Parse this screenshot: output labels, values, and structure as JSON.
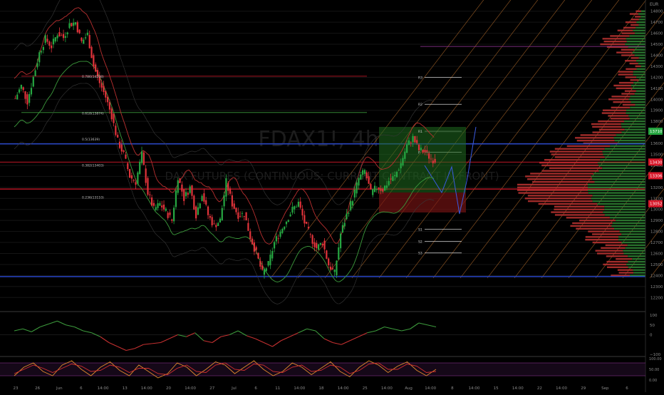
{
  "colors": {
    "background": "#000000",
    "up": "#26a641",
    "down": "#e0333a",
    "axis_text": "#8a8a8a",
    "grid": "#151515",
    "blue_line": "#2a4bd7",
    "red_line": "#d8182a",
    "ma_green": "#3c9a3c",
    "ma_red": "#b82f2f",
    "fib_orange": "#c87830",
    "purple": "#9b3aa0",
    "volume_up": "#2e7d32",
    "volume_down": "#b3312f",
    "rsi_line": "#c43030",
    "rsi_line_up": "#3c9a3c",
    "stoch_orange": "#e08a2c",
    "stoch_red": "#d03030"
  },
  "watermark": {
    "symbol": "FDAX1!, 4h",
    "description": "DAX FUTURES (CONTINUOUS: CURRENT CONTRACT IN FRONT)"
  },
  "price_axis": {
    "currency": "EUR",
    "labels": [
      "14800",
      "14700",
      "14600",
      "14500",
      "14400",
      "14300",
      "14200",
      "14100",
      "14000",
      "13900",
      "13800",
      "13700",
      "13600",
      "13500",
      "13400",
      "13300",
      "13200",
      "13100",
      "13000",
      "12900",
      "12800",
      "12700",
      "12600",
      "12500",
      "12400",
      "12300",
      "12200"
    ],
    "badges": [
      {
        "text": "13710",
        "price": 13710,
        "color": "#26a641"
      },
      {
        "text": "13430",
        "price": 13430,
        "color": "#d8182a"
      },
      {
        "text": "13306",
        "price": 13306,
        "color": "#d8182a"
      },
      {
        "text": "13052",
        "price": 13052,
        "color": "#d8182a"
      }
    ]
  },
  "time_axis": {
    "labels": [
      {
        "text": "23"
      },
      {
        "text": "26"
      },
      {
        "text": "Jun"
      },
      {
        "text": "6"
      },
      {
        "text": "14:00"
      },
      {
        "text": "13"
      },
      {
        "text": "14:00"
      },
      {
        "text": "20"
      },
      {
        "text": "14:00"
      },
      {
        "text": "27"
      },
      {
        "text": "Jul"
      },
      {
        "text": "6"
      },
      {
        "text": "11"
      },
      {
        "text": "14:00"
      },
      {
        "text": "18"
      },
      {
        "text": "14:00"
      },
      {
        "text": "25"
      },
      {
        "text": "14:00"
      },
      {
        "text": "Aug"
      },
      {
        "text": "14:00"
      },
      {
        "text": "8"
      },
      {
        "text": "14:00"
      },
      {
        "text": "15"
      },
      {
        "text": "14:00"
      },
      {
        "text": "22"
      },
      {
        "text": "14:00"
      },
      {
        "text": "29"
      },
      {
        "text": "Sep"
      },
      {
        "text": "6"
      }
    ]
  },
  "fib_labels": [
    {
      "text": "0.786(14208)",
      "price": 14208
    },
    {
      "text": "0.618(13874)",
      "price": 13874
    },
    {
      "text": "0.5(13639)",
      "price": 13639
    },
    {
      "text": "0.382(13403)",
      "price": 13403
    },
    {
      "text": "0.236(13110)",
      "price": 13110
    }
  ],
  "pivot_labels": [
    {
      "text": "R3",
      "price": 14200
    },
    {
      "text": "R2",
      "price": 13955
    },
    {
      "text": "R1",
      "price": 13710
    },
    {
      "text": "P",
      "price": 13520
    },
    {
      "text": "S1",
      "price": 12820
    },
    {
      "text": "S2",
      "price": 12710
    },
    {
      "text": "S3",
      "price": 12605
    }
  ],
  "rsi_axis": {
    "labels": [
      "100",
      "50",
      "0",
      "−100"
    ]
  },
  "stoch_axis": {
    "labels": [
      "100.00",
      "50.00",
      "0.00"
    ]
  },
  "chart_data": {
    "type": "candlestick",
    "symbol": "FDAX1!",
    "interval": "4h",
    "ylim": [
      12150,
      14900
    ],
    "horizontal_levels": [
      {
        "price": 13595,
        "color": "blue"
      },
      {
        "price": 12390,
        "color": "blue"
      },
      {
        "price": 13185,
        "color": "red"
      },
      {
        "price": 13430,
        "color": "red"
      },
      {
        "price": 14210,
        "color": "red"
      },
      {
        "price": 14480,
        "color": "purple"
      },
      {
        "price": 13880,
        "color": "green"
      }
    ],
    "candle_path": [
      14010,
      14120,
      13980,
      14200,
      14420,
      14550,
      14480,
      14600,
      14560,
      14680,
      14700,
      14520,
      14590,
      14300,
      14150,
      14020,
      13850,
      13620,
      13500,
      13300,
      13250,
      13500,
      13150,
      13000,
      13050,
      12980,
      12900,
      13300,
      13100,
      13200,
      12950,
      13150,
      12950,
      12850,
      12900,
      13250,
      13050,
      12950,
      12960,
      12750,
      12600,
      12420,
      12500,
      12700,
      12800,
      12900,
      13000,
      13060,
      12880,
      12750,
      12650,
      12700,
      12500,
      12420,
      12780,
      12950,
      13100,
      13280,
      13350,
      13150,
      13200,
      13180,
      13260,
      13300,
      13420,
      13580,
      13650,
      13540,
      13520,
      13460,
      13440
    ],
    "volume_profile_peak_price": 13180,
    "rsi": [
      20,
      30,
      15,
      40,
      55,
      70,
      50,
      40,
      20,
      10,
      -10,
      -40,
      -60,
      -80,
      -70,
      -50,
      -45,
      -40,
      -20,
      0,
      -10,
      10,
      -30,
      -40,
      -10,
      0,
      20,
      -5,
      -20,
      -40,
      -60,
      -30,
      -10,
      10,
      30,
      20,
      -20,
      -40,
      -50,
      -30,
      -10,
      10,
      20,
      40,
      30,
      20,
      30,
      60,
      50,
      40
    ],
    "stoch_k": [
      20,
      60,
      80,
      40,
      20,
      70,
      90,
      50,
      20,
      60,
      85,
      45,
      20,
      70,
      40,
      10,
      30,
      80,
      60,
      20,
      50,
      85,
      70,
      30,
      60,
      90,
      50,
      20,
      40,
      80,
      60,
      25,
      55,
      85,
      40,
      15,
      60,
      90,
      70,
      35,
      65,
      85,
      45,
      20,
      50
    ],
    "stoch_d": [
      30,
      50,
      70,
      55,
      35,
      55,
      75,
      65,
      40,
      45,
      70,
      60,
      35,
      55,
      55,
      30,
      25,
      55,
      70,
      40,
      35,
      70,
      80,
      50,
      45,
      75,
      70,
      40,
      35,
      60,
      70,
      40,
      45,
      70,
      60,
      30,
      45,
      75,
      80,
      50,
      50,
      75,
      65,
      35,
      40
    ]
  }
}
